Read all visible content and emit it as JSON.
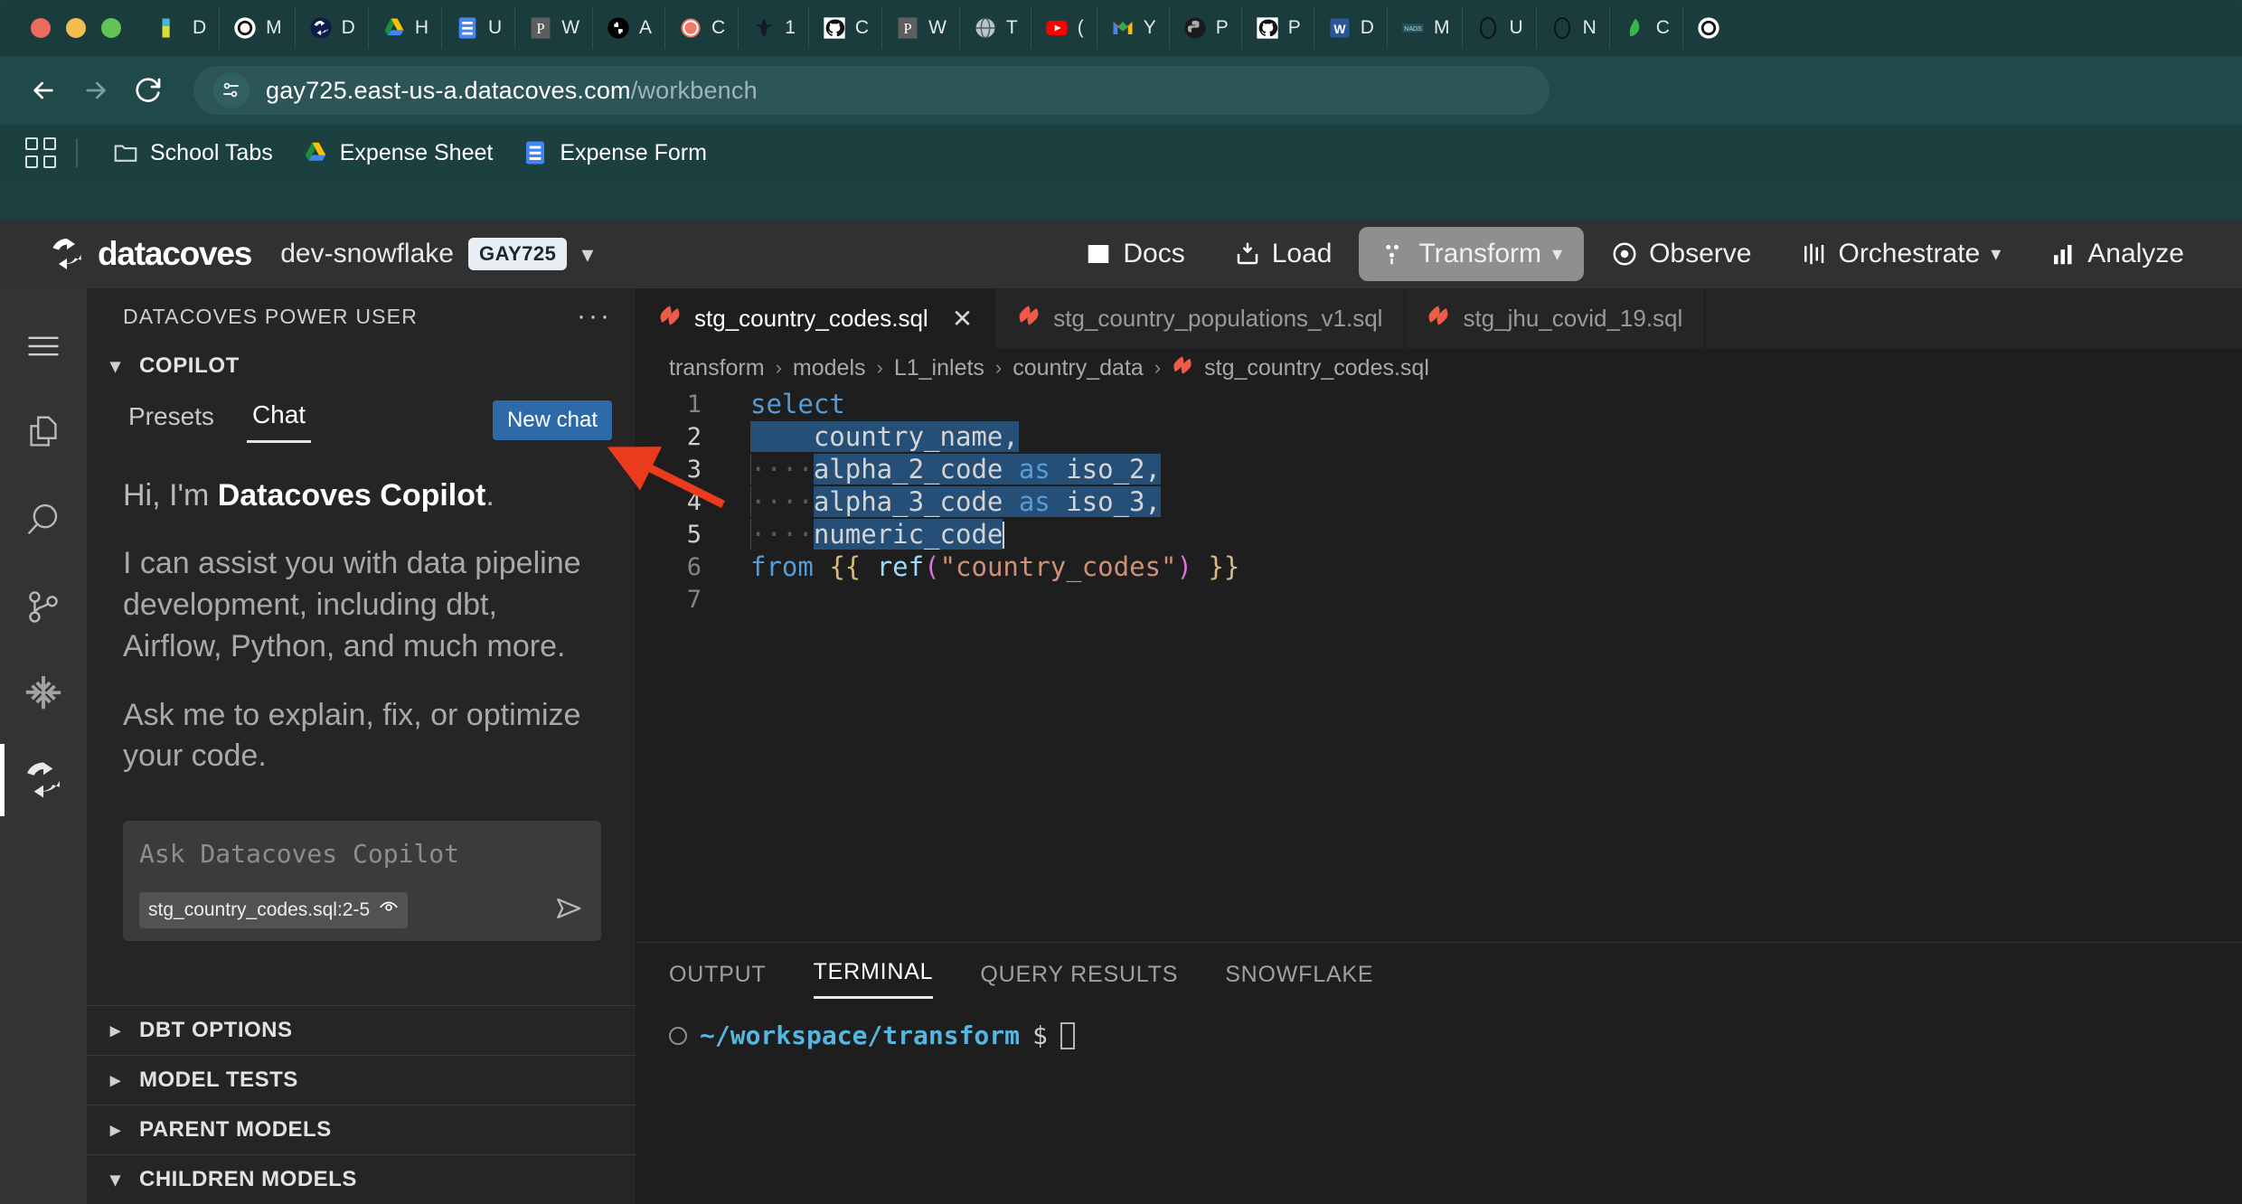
{
  "browser": {
    "tabs": [
      {
        "label": "D",
        "icon": "docs-icon"
      },
      {
        "label": "M",
        "icon": "openai-icon"
      },
      {
        "label": "D",
        "icon": "datacoves-icon"
      },
      {
        "label": "H",
        "icon": "drive-icon"
      },
      {
        "label": "U",
        "icon": "forms-icon"
      },
      {
        "label": "W",
        "icon": "powerpoint-icon"
      },
      {
        "label": "A",
        "icon": "slack-icon"
      },
      {
        "label": "C",
        "icon": "chatgpt-icon"
      },
      {
        "label": "1",
        "icon": "airflow-icon"
      },
      {
        "label": "C",
        "icon": "github-icon"
      },
      {
        "label": "W",
        "icon": "powerpoint-icon"
      },
      {
        "label": "T",
        "icon": "globe-icon"
      },
      {
        "label": "(",
        "icon": "youtube-icon"
      },
      {
        "label": "Y",
        "icon": "gmail-icon"
      },
      {
        "label": "P",
        "icon": "python-icon"
      },
      {
        "label": "P",
        "icon": "github-icon"
      },
      {
        "label": "D",
        "icon": "word-icon"
      },
      {
        "label": "M",
        "icon": "nads-icon"
      },
      {
        "label": "U",
        "icon": "quip-icon"
      },
      {
        "label": "N",
        "icon": "quip-icon"
      },
      {
        "label": "C",
        "icon": "leaf-icon"
      },
      {
        "label": "",
        "icon": "openai-icon"
      }
    ],
    "url_host": "gay725.east-us-a.datacoves.com",
    "url_path": "/workbench",
    "bookmarks": [
      {
        "label": "School Tabs",
        "icon": "folder-icon"
      },
      {
        "label": "Expense Sheet",
        "icon": "drive-icon"
      },
      {
        "label": "Expense Form",
        "icon": "forms-icon"
      }
    ]
  },
  "app": {
    "brand": "datacoves",
    "environment": "dev-snowflake",
    "env_badge": "GAY725",
    "nav": [
      {
        "label": "Docs",
        "icon": "book-icon",
        "active": false,
        "chevron": false
      },
      {
        "label": "Load",
        "icon": "load-icon",
        "active": false,
        "chevron": false
      },
      {
        "label": "Transform",
        "icon": "transform-icon",
        "active": true,
        "chevron": true
      },
      {
        "label": "Observe",
        "icon": "observe-icon",
        "active": false,
        "chevron": false
      },
      {
        "label": "Orchestrate",
        "icon": "orchestrate-icon",
        "active": false,
        "chevron": true
      },
      {
        "label": "Analyze",
        "icon": "analyze-icon",
        "active": false,
        "chevron": false
      }
    ]
  },
  "activity_bar": {
    "items": [
      {
        "icon": "hamburger-menu-icon",
        "active": false
      },
      {
        "icon": "files-icon",
        "active": false
      },
      {
        "icon": "search-icon",
        "active": false
      },
      {
        "icon": "source-control-icon",
        "active": false
      },
      {
        "icon": "snowflake-icon",
        "active": false
      },
      {
        "icon": "datacoves-icon",
        "active": true
      }
    ]
  },
  "sidebar": {
    "title": "DATACOVES POWER USER",
    "more_label": "···",
    "copilot_section": "COPILOT",
    "tabs": [
      {
        "label": "Presets",
        "active": false
      },
      {
        "label": "Chat",
        "active": true
      }
    ],
    "new_chat_label": "New chat",
    "greeting_prefix": "Hi, I'm ",
    "greeting_bold": "Datacoves Copilot",
    "greeting_suffix": ".",
    "paragraph_1": "I can assist you with data pipeline development, including dbt, Airflow, Python, and much more.",
    "paragraph_2": "Ask me to explain, fix, or optimize your code.",
    "composer_placeholder": "Ask Datacoves Copilot",
    "context_chip": "stg_country_codes.sql:2-5",
    "accordion": [
      {
        "label": "DBT OPTIONS",
        "expanded": false
      },
      {
        "label": "MODEL TESTS",
        "expanded": false
      },
      {
        "label": "PARENT MODELS",
        "expanded": false
      },
      {
        "label": "CHILDREN MODELS",
        "expanded": true
      }
    ]
  },
  "editor": {
    "tabs": [
      {
        "label": "stg_country_codes.sql",
        "active": true,
        "closable": true
      },
      {
        "label": "stg_country_populations_v1.sql",
        "active": false,
        "closable": false
      },
      {
        "label": "stg_jhu_covid_19.sql",
        "active": false,
        "closable": false
      }
    ],
    "breadcrumb": [
      "transform",
      "models",
      "L1_inlets",
      "country_data",
      "stg_country_codes.sql"
    ],
    "lines": [
      {
        "n": "1",
        "text": "select"
      },
      {
        "n": "2",
        "text": "    country_name,"
      },
      {
        "n": "3",
        "text": "    alpha_2_code as iso_2,"
      },
      {
        "n": "4",
        "text": "    alpha_3_code as iso_3,"
      },
      {
        "n": "5",
        "text": "    numeric_code"
      },
      {
        "n": "6",
        "text": "from {{ ref(\"country_codes\") }}"
      },
      {
        "n": "7",
        "text": ""
      }
    ],
    "selection": "lines 2-5"
  },
  "panel": {
    "tabs": [
      {
        "label": "OUTPUT",
        "active": false
      },
      {
        "label": "TERMINAL",
        "active": true
      },
      {
        "label": "QUERY RESULTS",
        "active": false
      },
      {
        "label": "SNOWFLAKE",
        "active": false
      }
    ],
    "terminal_path": "~/workspace/transform",
    "terminal_prompt": "$"
  },
  "annotation": {
    "arrow_color": "#ec3a1e",
    "points_to": "new-chat-button"
  },
  "colors": {
    "browser_chrome": "#1c3f3f",
    "app_header": "#313131",
    "sidebar_bg": "#252526",
    "editor_bg": "#1e1e1e",
    "accent_blue": "#2f6aa8",
    "selection_blue": "#264f78",
    "dbt_orange": "#ef5b48"
  }
}
